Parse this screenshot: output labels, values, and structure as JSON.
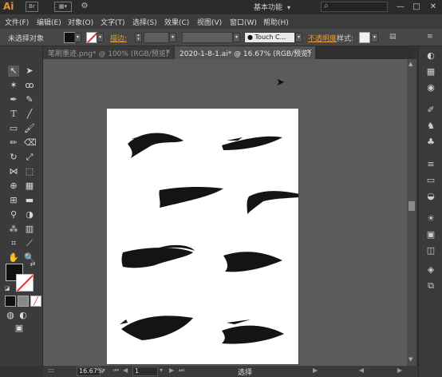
{
  "app": {
    "logo": "Ai",
    "bridge_label": "Br"
  },
  "workspace": {
    "label": "基本功能",
    "chevron": "▾"
  },
  "window_controls": {
    "minimize": "—",
    "maximize": "□",
    "close": "✕"
  },
  "menu": [
    "文件(F)",
    "编辑(E)",
    "对象(O)",
    "文字(T)",
    "选择(S)",
    "效果(C)",
    "视图(V)",
    "窗口(W)",
    "帮助(H)"
  ],
  "control_bar": {
    "selection_status": "未选择对象",
    "stroke_label": "描边:",
    "brush_name": "Touch C...",
    "opacity_label": "不透明度",
    "style_label": "样式:"
  },
  "tabs": [
    {
      "title": "笔刷墨迹.png* @ 100% (RGB/预览)",
      "close": "✕",
      "active": false
    },
    {
      "title": "2020-1-8-1.ai* @ 16.67% (RGB/预览)",
      "close": "✕",
      "active": true
    }
  ],
  "status_bar": {
    "zoom": "16.67%",
    "page": "1",
    "tool_status": "选择"
  },
  "colors": {
    "accent_orange": "#e8912d",
    "fill": "#111111",
    "stroke_none_slash": "#e03030",
    "canvas_bg": "#5b5b5b",
    "artboard": "#ffffff"
  }
}
